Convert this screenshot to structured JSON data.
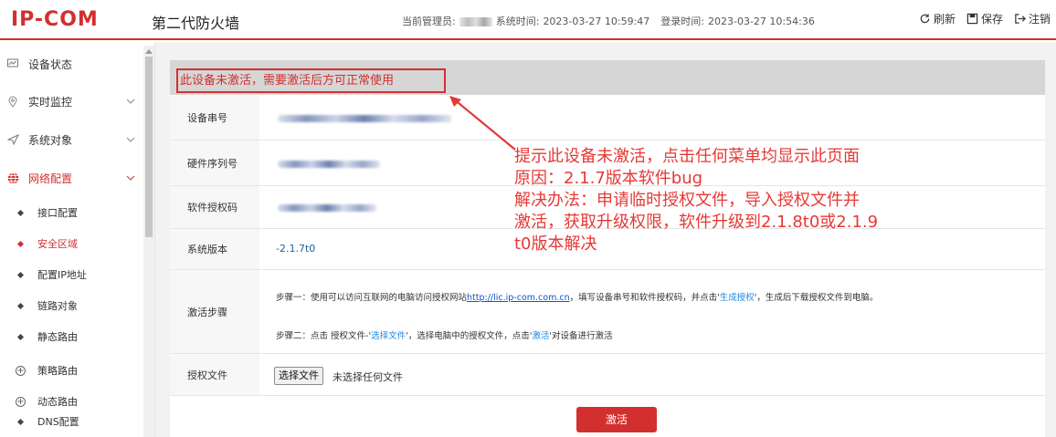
{
  "header": {
    "logo": "IP-COM",
    "product": "第二代防火墙",
    "admin_label": "当前管理员:",
    "system_time_label": "系统时间:",
    "system_time": "2023-03-27 10:59:47",
    "login_time_label": "登录时间:",
    "login_time": "2023-03-27 10:54:36",
    "actions": {
      "refresh": "刷新",
      "save": "保存",
      "logout": "注销"
    }
  },
  "sidebar": {
    "items": [
      {
        "label": "设备状态",
        "icon": "monitor-icon"
      },
      {
        "label": "实时监控",
        "icon": "location-icon"
      },
      {
        "label": "系统对象",
        "icon": "send-icon"
      },
      {
        "label": "网络配置",
        "icon": "globe-icon"
      }
    ],
    "subitems": [
      {
        "label": "接口配置"
      },
      {
        "label": "安全区域"
      },
      {
        "label": "配置IP地址"
      },
      {
        "label": "链路对象"
      },
      {
        "label": "静态路由"
      },
      {
        "label": "策略路由"
      },
      {
        "label": "动态路由"
      },
      {
        "label": "DNS配置"
      }
    ]
  },
  "main": {
    "notice": "此设备未激活，需要激活后方可正常使用",
    "rows": {
      "serial_label": "设备串号",
      "hw_label": "硬件序列号",
      "license_label": "软件授权码",
      "version_label": "系统版本",
      "version_value": "-2.1.7t0",
      "steps_label": "激活步骤",
      "file_label": "授权文件"
    },
    "step1_a": "步骤一：使用可以访问互联网的电脑访问授权网站",
    "step1_link": "http://lic.ip-com.com.cn",
    "step1_b": "，填写设备串号和软件授权码，并点击'",
    "step1_btn": "生成授权",
    "step1_c": "'，生成后下载授权文件到电脑。",
    "step2_a": "步骤二：点击 授权文件-'",
    "step2_btn": "选择文件",
    "step2_b": "'，选择电脑中的授权文件，点击'",
    "step2_btn2": "激活",
    "step2_c": "'对设备进行激活",
    "choose_file": "选择文件",
    "no_file": "未选择任何文件",
    "activate": "激活"
  },
  "annotation": [
    "提示此设备未激活，点击任何菜单均显示此页面",
    "原因：2.1.7版本软件bug",
    "解决办法：申请临时授权文件，导入授权文件并",
    "激活，获取升级权限，软件升级到2.1.8t0或2.1.9",
    "t0版本解决"
  ],
  "colors": {
    "brand": "#d32f2f",
    "annotation": "#e53935",
    "link": "#1155cc"
  }
}
